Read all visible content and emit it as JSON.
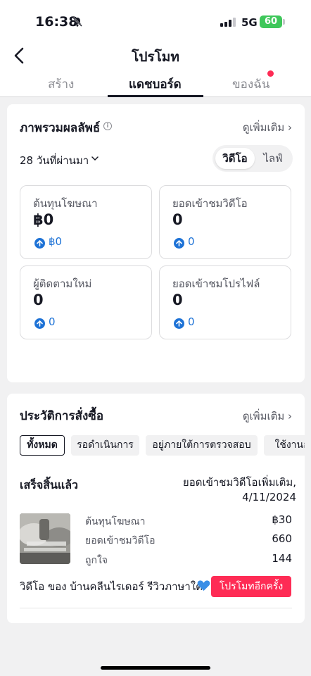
{
  "status_bar": {
    "time": "16:38",
    "network": "5G",
    "battery": "60"
  },
  "header": {
    "title": "โปรโมท"
  },
  "tabs": [
    {
      "label": "สร้าง"
    },
    {
      "label": "แดชบอร์ด"
    },
    {
      "label": "ของฉัน"
    }
  ],
  "overview": {
    "title": "ภาพรวมผลลัพธ์",
    "see_more": "ดูเพิ่มเติม",
    "range": "28 วันที่ผ่านมา",
    "segments": [
      "วิดีโอ",
      "ไลฟ์"
    ],
    "metrics": [
      {
        "label": "ต้นทุนโฆษณา",
        "value": "฿0",
        "change": "฿0"
      },
      {
        "label": "ยอดเข้าชมวิดีโอ",
        "value": "0",
        "change": "0"
      },
      {
        "label": "ผู้ติดตามใหม่",
        "value": "0",
        "change": "0"
      },
      {
        "label": "ยอดเข้าชมโปรไฟล์",
        "value": "0",
        "change": "0"
      }
    ]
  },
  "orders": {
    "title": "ประวัติการสั่งซื้อ",
    "see_more": "ดูเพิ่มเติม",
    "filters": [
      "ทั้งหมด",
      "รอดำเนินการ",
      "อยู่ภายใต้การตรวจสอบ",
      "ใช้งานอ"
    ],
    "item": {
      "status": "เสร็จสิ้นแล้ว",
      "goal": "ยอดเข้าชมวิดีโอเพิ่มเติม,",
      "date": "4/11/2024",
      "rows": [
        {
          "label": "ต้นทุนโฆษณา",
          "value": "฿30"
        },
        {
          "label": "ยอดเข้าชมวิดีโอ",
          "value": "660"
        },
        {
          "label": "ถูกใจ",
          "value": "144"
        }
      ],
      "video_title": "วิดีโอ ของ บ้านคลีนไรเดอร์ รีวิวภาษาใต้",
      "promote_again": "โปรโมทอีกครั้ง"
    }
  },
  "colors": {
    "accent": "#fe2c55",
    "link_blue": "#1d72d6",
    "battery": "#3ec75a"
  }
}
